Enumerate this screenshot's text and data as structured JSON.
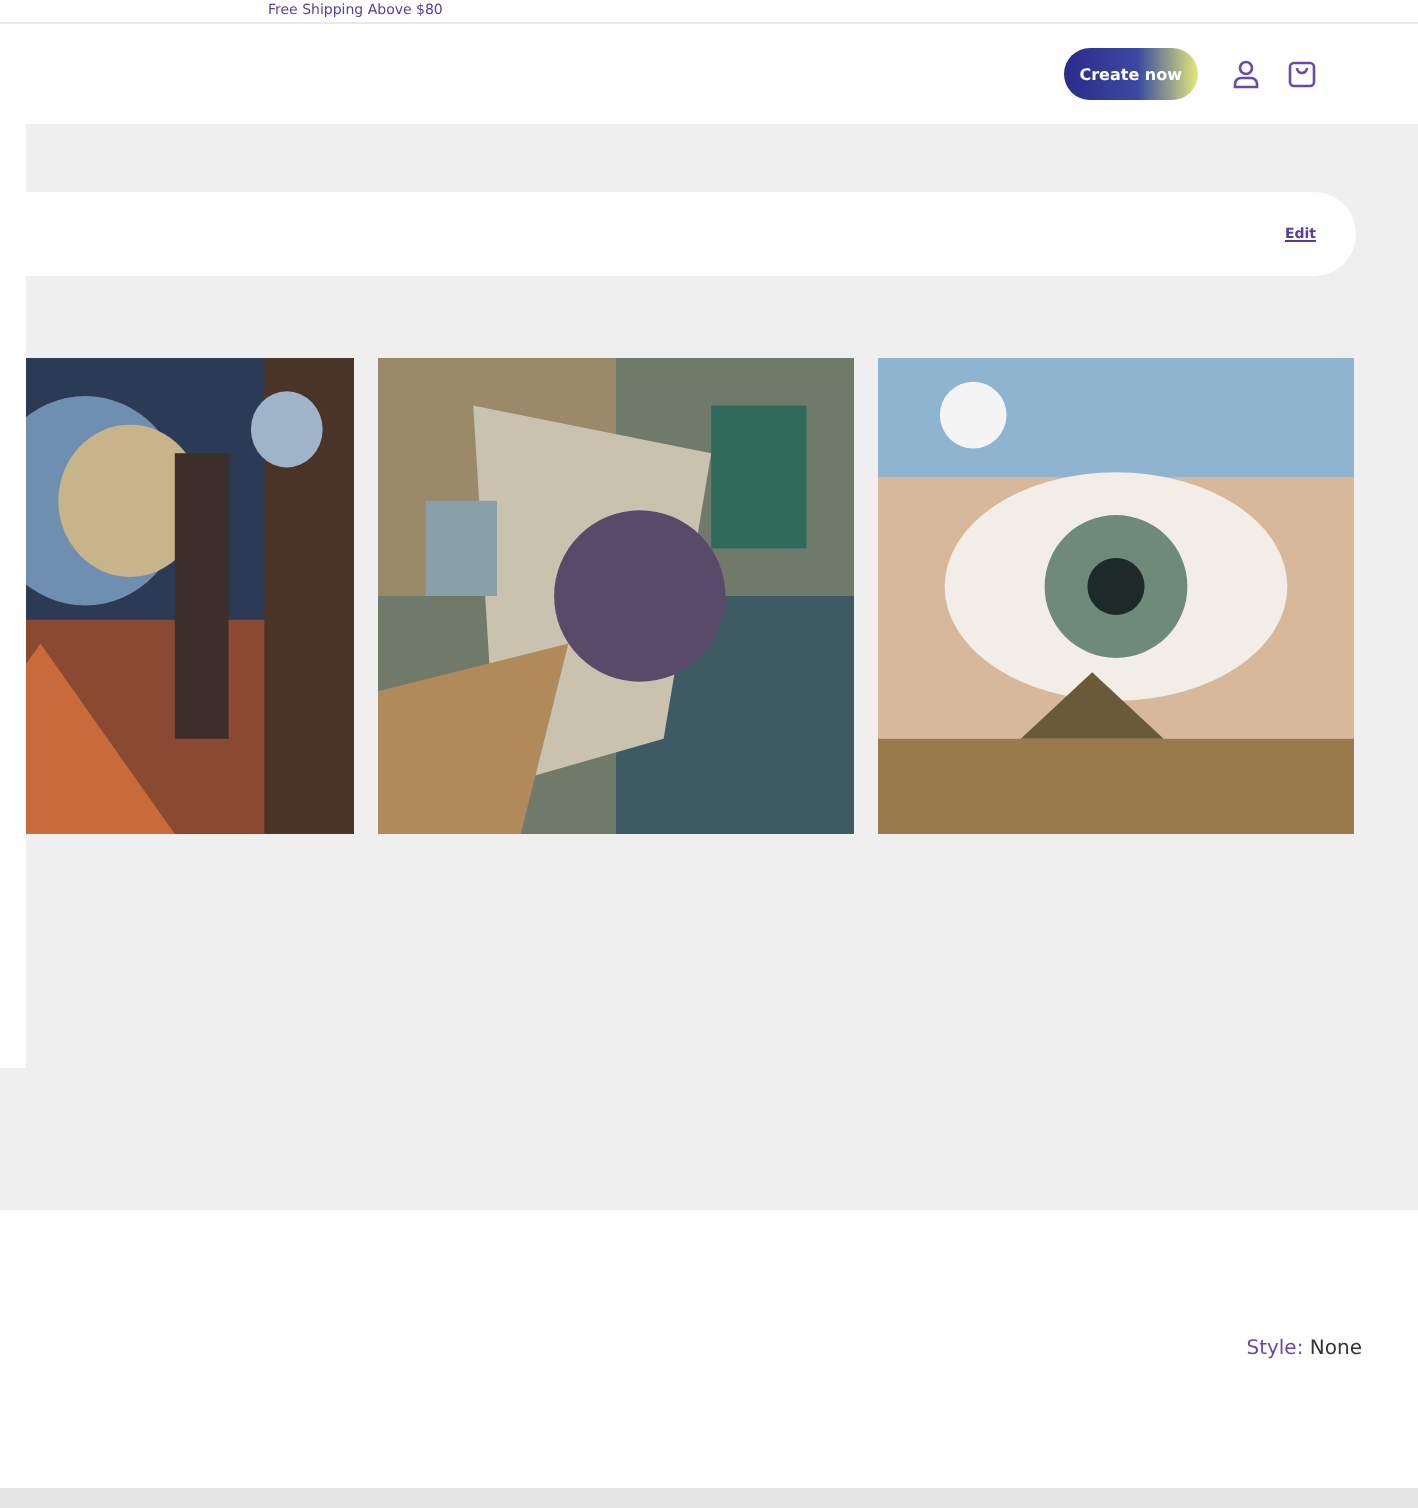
{
  "announcement": "Free Shipping Above $80",
  "header": {
    "button": "Create now"
  },
  "card": {
    "link": "Edit"
  },
  "options": {
    "label": "Style:",
    "value": "None"
  }
}
